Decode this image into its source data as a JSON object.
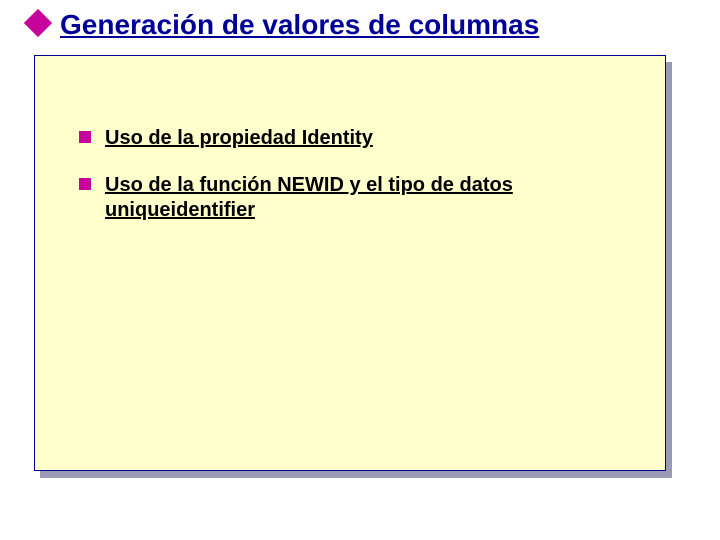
{
  "title": "Generación de valores de columnas",
  "items": [
    {
      "label": "Uso de la propiedad Identity"
    },
    {
      "label": "Uso de la función NEWID y el tipo de datos uniqueidentifier"
    }
  ]
}
